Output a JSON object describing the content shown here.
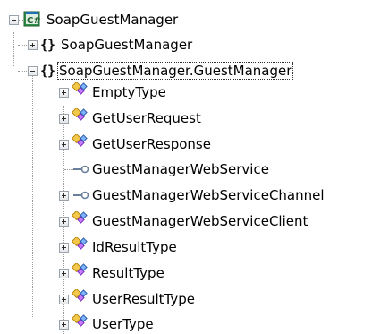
{
  "tree": {
    "root": {
      "label": "SoapGuestManager",
      "icon": "project-icon",
      "expanded": true
    },
    "namespaces": [
      {
        "label": "SoapGuestManager",
        "icon": "namespace-icon",
        "expanded": false
      },
      {
        "label": "SoapGuestManager.GuestManager",
        "icon": "namespace-icon",
        "expanded": true,
        "selected": true
      }
    ],
    "types": [
      {
        "label": "EmptyType",
        "icon": "class-icon",
        "expandable": true
      },
      {
        "label": "GetUserRequest",
        "icon": "class-icon",
        "expandable": true
      },
      {
        "label": "GetUserResponse",
        "icon": "class-icon",
        "expandable": true
      },
      {
        "label": "GuestManagerWebService",
        "icon": "interface-icon",
        "expandable": false
      },
      {
        "label": "GuestManagerWebServiceChannel",
        "icon": "interface-icon",
        "expandable": true
      },
      {
        "label": "GuestManagerWebServiceClient",
        "icon": "class-icon",
        "expandable": true
      },
      {
        "label": "IdResultType",
        "icon": "class-icon",
        "expandable": true
      },
      {
        "label": "ResultType",
        "icon": "class-icon",
        "expandable": true
      },
      {
        "label": "UserResultType",
        "icon": "class-icon",
        "expandable": true
      },
      {
        "label": "UserType",
        "icon": "class-icon",
        "expandable": true
      }
    ]
  }
}
